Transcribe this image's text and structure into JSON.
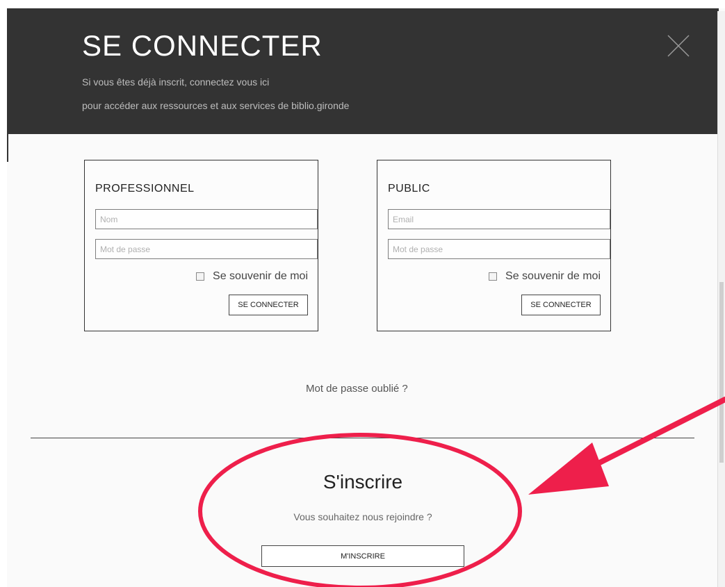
{
  "modal": {
    "title": "SE CONNECTER",
    "subtitle_line1": "Si vous êtes déjà inscrit, connectez vous ici",
    "subtitle_line2": "pour accéder aux ressources et aux services de biblio.gironde",
    "close_icon": "close-icon"
  },
  "professional": {
    "title": "PROFESSIONNEL",
    "name_placeholder": "Nom",
    "password_placeholder": "Mot de passe",
    "remember_label": "Se souvenir de moi",
    "submit_label": "SE CONNECTER"
  },
  "public": {
    "title": "PUBLIC",
    "email_placeholder": "Email",
    "password_placeholder": "Mot de passe",
    "remember_label": "Se souvenir de moi",
    "submit_label": "SE CONNECTER"
  },
  "forgot_password": "Mot de passe oublié ?",
  "register": {
    "title": "S'inscrire",
    "subtitle": "Vous souhaitez nous rejoindre ?",
    "button_label": "M'INSCRIRE"
  },
  "annotation": {
    "color": "#ee1f4b"
  }
}
